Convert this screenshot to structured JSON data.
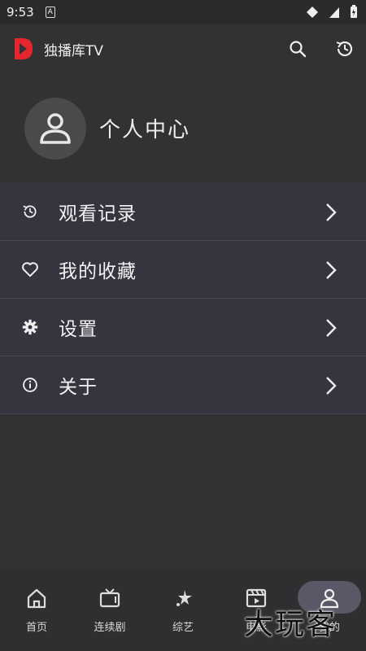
{
  "status_bar": {
    "time": "9:53",
    "notif_glyph": "A"
  },
  "app_bar": {
    "title": "独播库TV",
    "brand_color": "#e5262c"
  },
  "profile": {
    "name": "个人中心"
  },
  "menu": {
    "items": [
      {
        "label": "观看记录",
        "icon": "history-icon"
      },
      {
        "label": "我的收藏",
        "icon": "heart-icon"
      },
      {
        "label": "设置",
        "icon": "gear-icon"
      },
      {
        "label": "关于",
        "icon": "info-icon"
      }
    ]
  },
  "bottom_nav": {
    "items": [
      {
        "label": "首页",
        "icon": "home-icon"
      },
      {
        "label": "连续剧",
        "icon": "tv-icon"
      },
      {
        "label": "综艺",
        "icon": "star-icon"
      },
      {
        "label": "电影",
        "icon": "film-icon"
      },
      {
        "label": "我的",
        "icon": "user-icon"
      }
    ],
    "active_index": 4
  },
  "watermark": {
    "text": "大玩客"
  }
}
